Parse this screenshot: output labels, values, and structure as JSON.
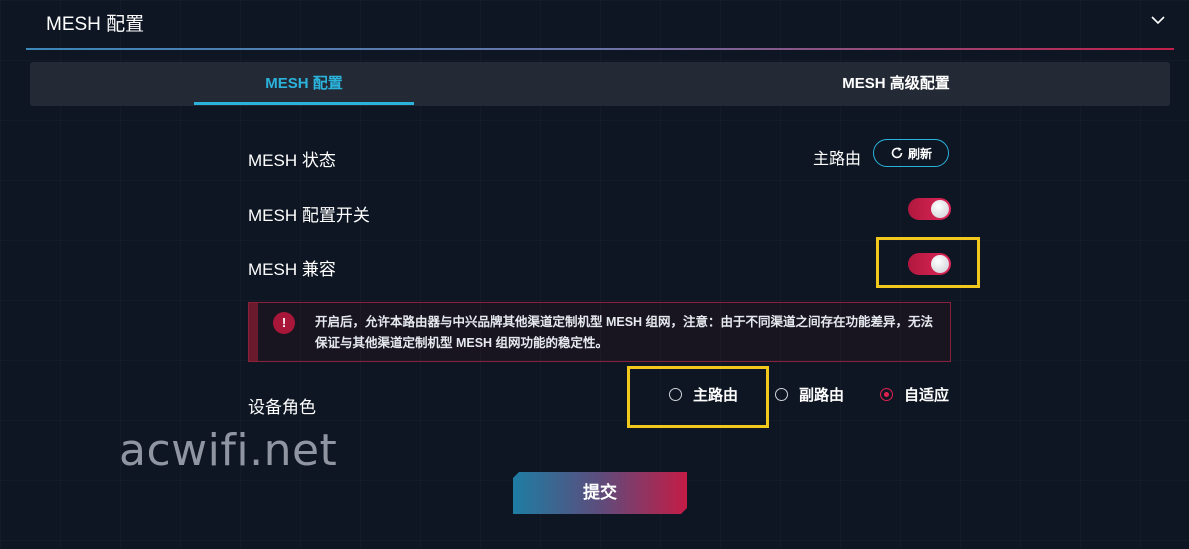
{
  "section": {
    "title": "MESH 配置"
  },
  "tabs": [
    {
      "label": "MESH 配置",
      "active": true
    },
    {
      "label": "MESH 高级配置",
      "active": false
    }
  ],
  "mesh_status": {
    "label": "MESH 状态",
    "value": "主路由",
    "refresh_label": "刷新"
  },
  "mesh_switch": {
    "label": "MESH 配置开关",
    "enabled": true
  },
  "mesh_compat": {
    "label": "MESH 兼容",
    "enabled": true
  },
  "warning": {
    "icon": "!",
    "text": "开启后，允许本路由器与中兴品牌其他渠道定制机型 MESH 组网，注意：由于不同渠道之间存在功能差异，无法保证与其他渠道定制机型 MESH 组网功能的稳定性。"
  },
  "device_role": {
    "label": "设备角色",
    "options": [
      "主路由",
      "副路由",
      "自适应"
    ],
    "selected": "自适应"
  },
  "submit_label": "提交",
  "watermark": "acwifi.net",
  "colors": {
    "accent": "#2bb3dc",
    "danger": "#e0214f",
    "highlight": "#f3c81c",
    "background": "#0e1623"
  }
}
